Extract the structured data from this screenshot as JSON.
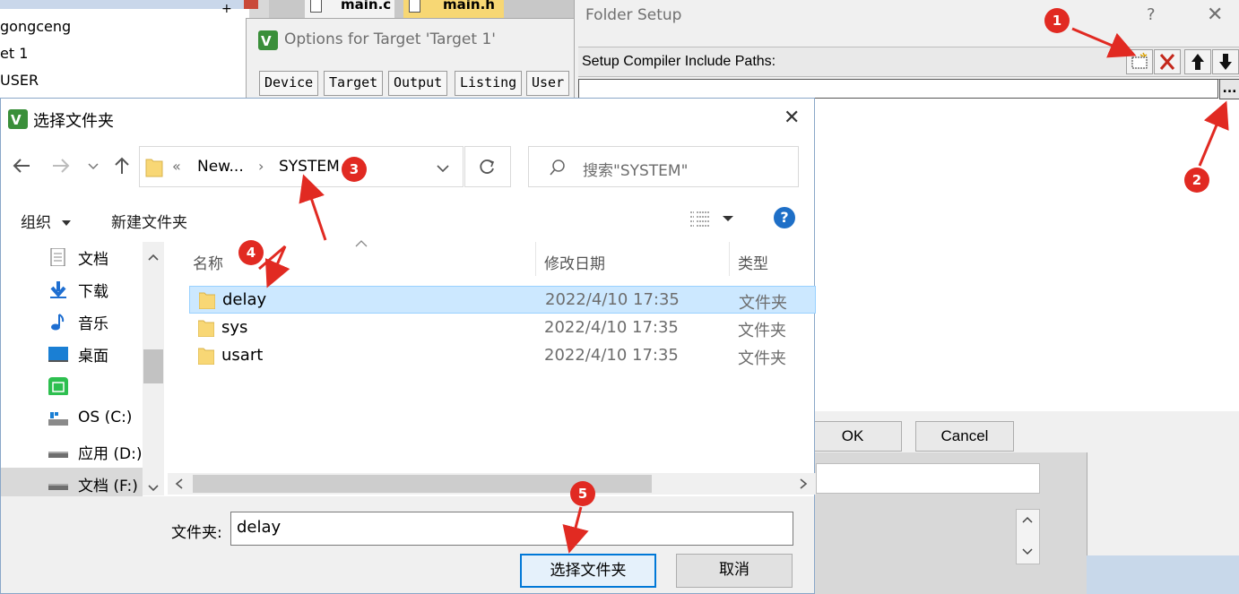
{
  "project_tree": {
    "items": [
      "gongceng",
      "et 1",
      "USER"
    ]
  },
  "editor_tabs": [
    "main.c",
    "main.h"
  ],
  "options_dialog": {
    "title": "Options for Target 'Target 1'",
    "tabs": [
      "Device",
      "Target",
      "Output",
      "Listing",
      "User"
    ]
  },
  "folder_setup": {
    "title": "Folder Setup",
    "help": "?",
    "close": "✕",
    "label": "Setup Compiler Include Paths:",
    "path_value": "",
    "browse": "...",
    "ok": "OK",
    "cancel": "Cancel"
  },
  "select_folder": {
    "title": "选择文件夹",
    "close": "✕",
    "breadcrumb": {
      "overflow": "«",
      "parent": "New...",
      "separator": "›",
      "current": "SYSTEM"
    },
    "search_placeholder": "搜索\"SYSTEM\"",
    "toolbar": {
      "organize": "组织",
      "new_folder": "新建文件夹",
      "help": "?"
    },
    "nav_items": [
      {
        "label": "文档",
        "icon": "document-icon"
      },
      {
        "label": "下载",
        "icon": "download-icon"
      },
      {
        "label": "音乐",
        "icon": "music-icon"
      },
      {
        "label": "桌面",
        "icon": "desktop-icon"
      },
      {
        "label": "",
        "icon": "app-icon"
      },
      {
        "label": "OS (C:)",
        "icon": "drive-icon"
      },
      {
        "label": "应用 (D:)",
        "icon": "drive-icon"
      },
      {
        "label": "文档 (F:)",
        "icon": "drive-icon"
      }
    ],
    "columns": {
      "name": "名称",
      "date": "修改日期",
      "type": "类型"
    },
    "files": [
      {
        "name": "delay",
        "date": "2022/4/10 17:35",
        "type": "文件夹"
      },
      {
        "name": "sys",
        "date": "2022/4/10 17:35",
        "type": "文件夹"
      },
      {
        "name": "usart",
        "date": "2022/4/10 17:35",
        "type": "文件夹"
      }
    ],
    "folder_label": "文件夹:",
    "folder_value": "delay",
    "select_button": "选择文件夹",
    "cancel_button": "取消"
  },
  "annotations": [
    "1",
    "2",
    "3",
    "4",
    "5"
  ],
  "colors": {
    "annotation": "#e12a22",
    "selection": "#cce8ff",
    "folder": "#f8d775",
    "help_blue": "#1e6fc7"
  }
}
